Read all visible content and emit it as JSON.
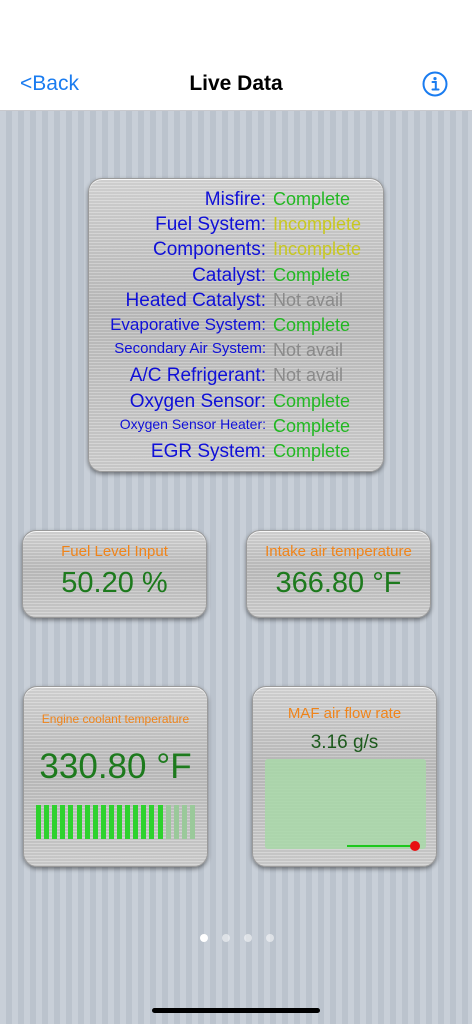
{
  "nav": {
    "back_label": "<Back",
    "title": "Live Data",
    "info_icon": "info-circle-icon"
  },
  "monitor_status": [
    {
      "label": "Misfire:",
      "value": "Complete",
      "status": "complete"
    },
    {
      "label": "Fuel System:",
      "value": "Incomplete",
      "status": "incomplete"
    },
    {
      "label": "Components:",
      "value": "Incomplete",
      "status": "incomplete"
    },
    {
      "label": "Catalyst:",
      "value": "Complete",
      "status": "complete"
    },
    {
      "label": "Heated Catalyst:",
      "value": "Not avail",
      "status": "na"
    },
    {
      "label": "Evaporative System:",
      "value": "Complete",
      "status": "complete"
    },
    {
      "label": "Secondary Air System:",
      "value": "Not avail",
      "status": "na"
    },
    {
      "label": "A/C Refrigerant:",
      "value": "Not avail",
      "status": "na"
    },
    {
      "label": "Oxygen Sensor:",
      "value": "Complete",
      "status": "complete"
    },
    {
      "label": "Oxygen Sensor Heater:",
      "value": "Complete",
      "status": "complete"
    },
    {
      "label": "EGR System:",
      "value": "Complete",
      "status": "complete"
    }
  ],
  "gauges": {
    "fuel_level": {
      "title": "Fuel Level Input",
      "value": "50.20 %"
    },
    "intake_air": {
      "title": "Intake air temperature",
      "value": "366.80 °F"
    },
    "coolant": {
      "title": "Engine coolant temperature",
      "value": "330.80 °F",
      "bar_level": 0.8,
      "segments": 20
    },
    "maf": {
      "title": "MAF air flow rate",
      "value": "3.16 g/s"
    }
  },
  "pager": {
    "count": 4,
    "active": 0
  },
  "colors": {
    "label_blue": "#1010d8",
    "complete": "#22b822",
    "incomplete": "#c8c820",
    "na": "#8a8a8a",
    "title_orange": "#f0841a",
    "value_green": "#1d7a1d",
    "bar_on": "#2ed22e",
    "bar_off": "#9ac99a",
    "accent": "#1a7cf0"
  }
}
